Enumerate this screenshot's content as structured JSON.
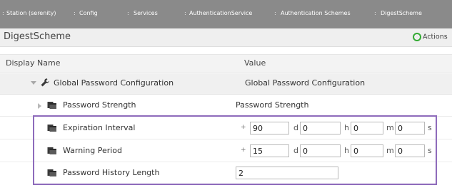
{
  "breadcrumb": [
    {
      "label": "Station (serenity)"
    },
    {
      "label": "Config"
    },
    {
      "label": "Services"
    },
    {
      "label": "AuthenticationService"
    },
    {
      "label": "Authentication Schemes"
    },
    {
      "label": "DigestScheme"
    }
  ],
  "page": {
    "title": "DigestScheme",
    "actions_label": "Actions"
  },
  "columns": {
    "name": "Display Name",
    "value": "Value"
  },
  "rows": {
    "global": {
      "name": "Global Password Configuration",
      "value": "Global Password Configuration"
    },
    "strength": {
      "name": "Password Strength",
      "value": "Password Strength"
    },
    "expiration": {
      "name": "Expiration Interval",
      "sign": "+",
      "days": "90",
      "hours": "0",
      "minutes": "0",
      "seconds": "0",
      "u_d": "d",
      "u_h": "h",
      "u_m": "m",
      "u_s": "s"
    },
    "warning": {
      "name": "Warning Period",
      "sign": "+",
      "days": "15",
      "hours": "0",
      "minutes": "0",
      "seconds": "0",
      "u_d": "d",
      "u_h": "h",
      "u_m": "m",
      "u_s": "s"
    },
    "history": {
      "name": "Password History Length",
      "value": "2"
    }
  },
  "colors": {
    "highlight": "#8e6bbb",
    "actions_ring": "#33aa33"
  },
  "icons": [
    "wrench-icon",
    "folder-icon",
    "expand-triangle-icon",
    "collapse-triangle-icon",
    "actions-ring-icon"
  ]
}
